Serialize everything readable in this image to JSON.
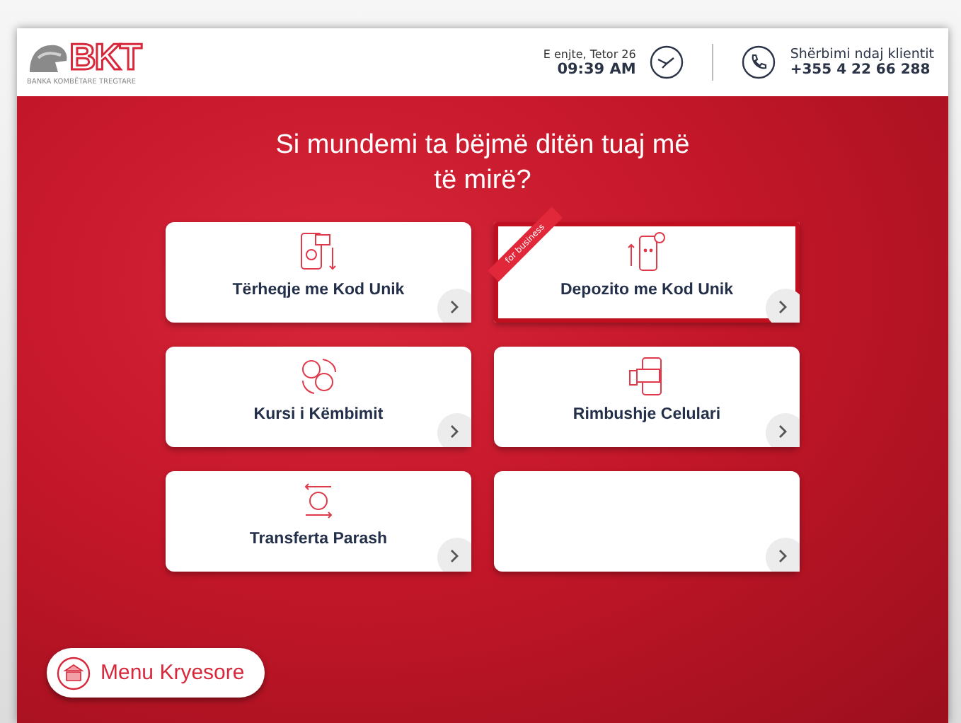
{
  "header": {
    "logo_text": "BKT",
    "logo_subtitle": "BANKA KOMBËTARE TREGTARE",
    "date": "E enjte, Tetor 26",
    "time": "09:39 AM",
    "support_label": "Shërbimi ndaj klientit",
    "support_phone": "+355 4 22 66 288"
  },
  "title": "Si mundemi ta bëjmë ditën tuaj më të mirë?",
  "tiles": [
    {
      "label": "Tërheqje me Kod Unik",
      "selected": false
    },
    {
      "label": "Depozito me Kod Unik",
      "selected": true,
      "ribbon": "for business"
    },
    {
      "label": "Kursi i Këmbimit",
      "selected": false
    },
    {
      "label": "Rimbushje Celulari",
      "selected": false
    },
    {
      "label": "Transferta Parash",
      "selected": false
    },
    {
      "selected": false
    }
  ],
  "main_menu_button": "Menu Kryesore"
}
